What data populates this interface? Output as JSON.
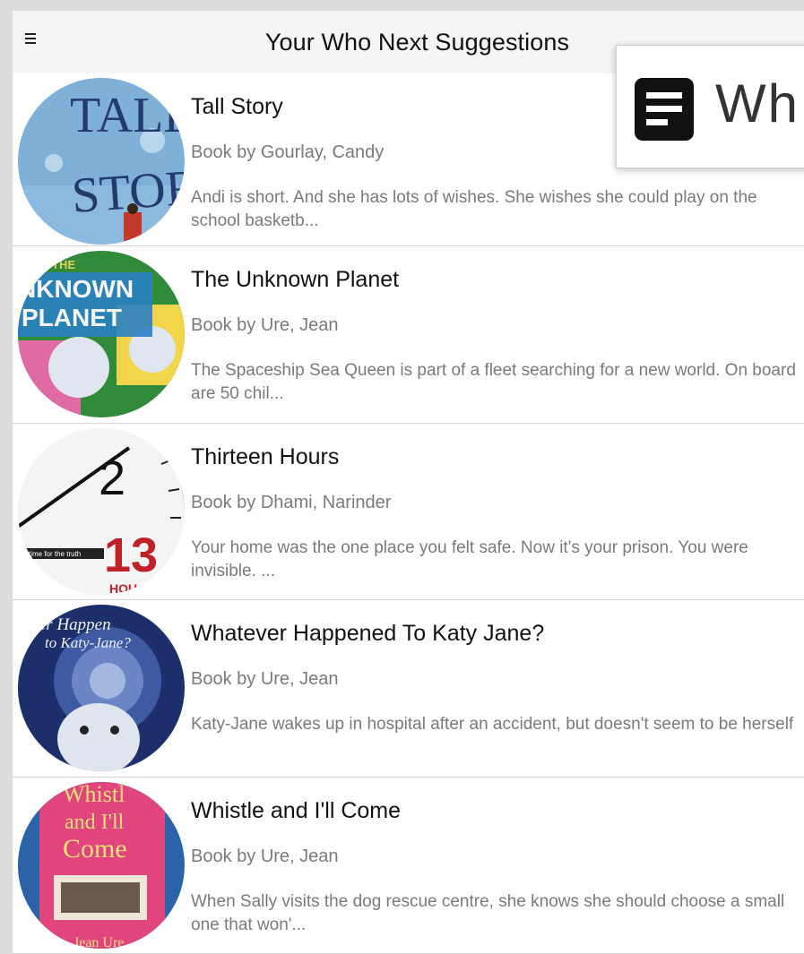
{
  "header": {
    "title": "Your Who Next Suggestions",
    "menu_icon": "hamburger-menu-icon"
  },
  "zoom_overlay": {
    "text": "Wh",
    "icon": "document-lines-icon"
  },
  "books": [
    {
      "title": "Tall Story",
      "author": "Book by Gourlay, Candy",
      "description": "Andi is short. And she has lots of wishes. She wishes she could play on the school basketb...",
      "cover_text": [
        "TALL",
        "STORY"
      ]
    },
    {
      "title": "The Unknown Planet",
      "author": "Book by Ure, Jean",
      "description": "The Spaceship Sea Queen is part of a fleet searching for a new world. On board are 50 chil...",
      "cover_text": [
        "THE",
        "NKNOWN",
        "PLANET"
      ]
    },
    {
      "title": "Thirteen Hours",
      "author": "Book by Dhami, Narinder",
      "description": "Your home was the one place you felt safe.  Now it's your prison. You were invisible.  ...",
      "cover_text": [
        "2",
        "13",
        "HOU",
        "is time for the truth"
      ]
    },
    {
      "title": "Whatever Happened To Katy Jane?",
      "author": "Book by Ure, Jean",
      "description": "Katy-Jane wakes up in hospital after an accident, but doesn't seem to be herself",
      "cover_text": [
        "ever Happen",
        "to Katy-Jane?"
      ]
    },
    {
      "title": "Whistle and I'll Come",
      "author": "Book by Ure, Jean",
      "description": "When Sally visits the dog rescue centre, she knows she should choose a small one that won'...",
      "cover_text": [
        "Whistl",
        "and I'll",
        "Come",
        "Jean Ure"
      ]
    }
  ]
}
